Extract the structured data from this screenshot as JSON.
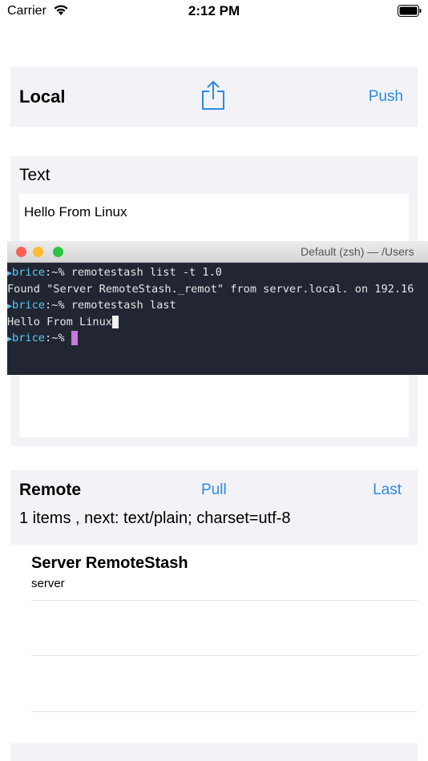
{
  "status_bar": {
    "carrier": "Carrier",
    "time": "2:12 PM"
  },
  "local": {
    "title": "Local",
    "share_icon": "share-icon",
    "push_label": "Push"
  },
  "text_section": {
    "label": "Text",
    "value": "Hello From Linux"
  },
  "terminal": {
    "title": "Default (zsh) — /Users",
    "lines": [
      {
        "user": "brice",
        "sep": ":~% ",
        "cmd": "remotestash list -t 1.0"
      },
      {
        "output": "Found \"Server RemoteStash._remot\" from server.local. on 192.16"
      },
      {
        "user": "brice",
        "sep": ":~% ",
        "cmd": "remotestash last"
      },
      {
        "output": "Hello From Linux"
      },
      {
        "user": "brice",
        "sep": ":~% ",
        "cmd": ""
      }
    ]
  },
  "remote": {
    "title": "Remote",
    "pull_label": "Pull",
    "last_label": "Last",
    "status": "1 items , next: text/plain; charset=utf-8"
  },
  "list": {
    "items": [
      {
        "title": "Server RemoteStash",
        "subtitle": "server"
      },
      {
        "title": "",
        "subtitle": ""
      },
      {
        "title": "",
        "subtitle": ""
      }
    ]
  },
  "colors": {
    "accent": "#2a8ce2",
    "panel_bg": "#f2f2f7",
    "terminal_bg": "#222633",
    "prompt": "#5cc9f5",
    "cursor": "#c678dd"
  }
}
